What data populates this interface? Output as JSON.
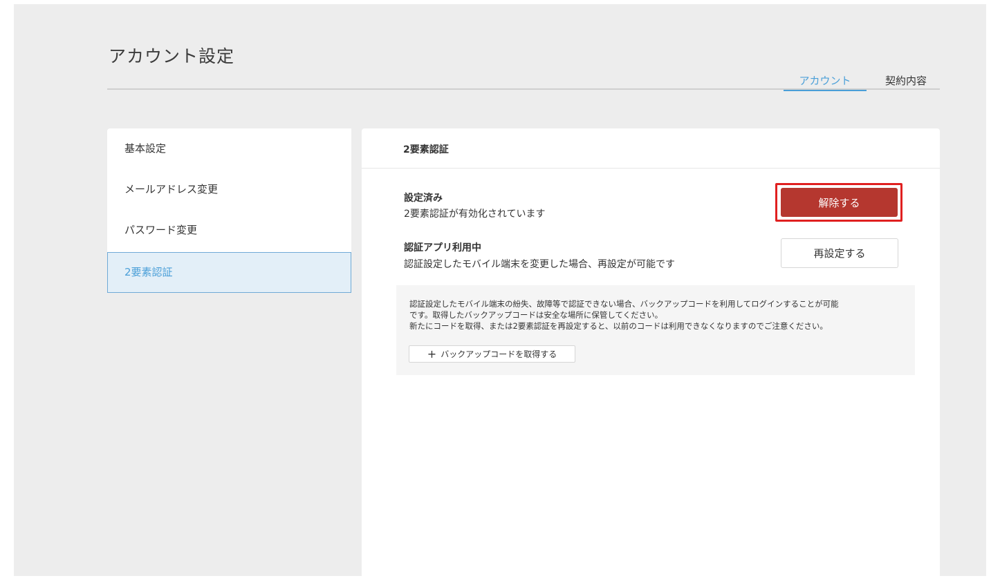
{
  "page": {
    "title": "アカウント設定"
  },
  "tabs": [
    {
      "label": "アカウント",
      "active": true
    },
    {
      "label": "契約内容",
      "active": false
    }
  ],
  "sidebar": {
    "items": [
      {
        "label": "基本設定"
      },
      {
        "label": "メールアドレス変更"
      },
      {
        "label": "パスワード変更"
      },
      {
        "label": "2要素認証",
        "active": true
      }
    ]
  },
  "panel": {
    "title": "2要素認証",
    "status": {
      "title": "設定済み",
      "desc": "2要素認証が有効化されています",
      "button": "解除する"
    },
    "app": {
      "title": "認証アプリ利用中",
      "desc": "認証設定したモバイル端末を変更した場合、再設定が可能です",
      "button": "再設定する"
    },
    "backup": {
      "lines": [
        "認証設定したモバイル端末の紛失、故障等で認証できない場合、バックアップコードを利用してログインすることが可能",
        "です。取得したバックアップコードは安全な場所に保管してください。",
        "新たにコードを取得、または2要素認証を再設定すると、以前のコードは利用できなくなりますのでご注意ください。"
      ],
      "button": "バックアップコードを取得する",
      "button_icon": "plus-icon"
    }
  },
  "colors": {
    "accent": "#4a9fd8",
    "danger": "#b5372f",
    "highlight": "#e02020"
  }
}
